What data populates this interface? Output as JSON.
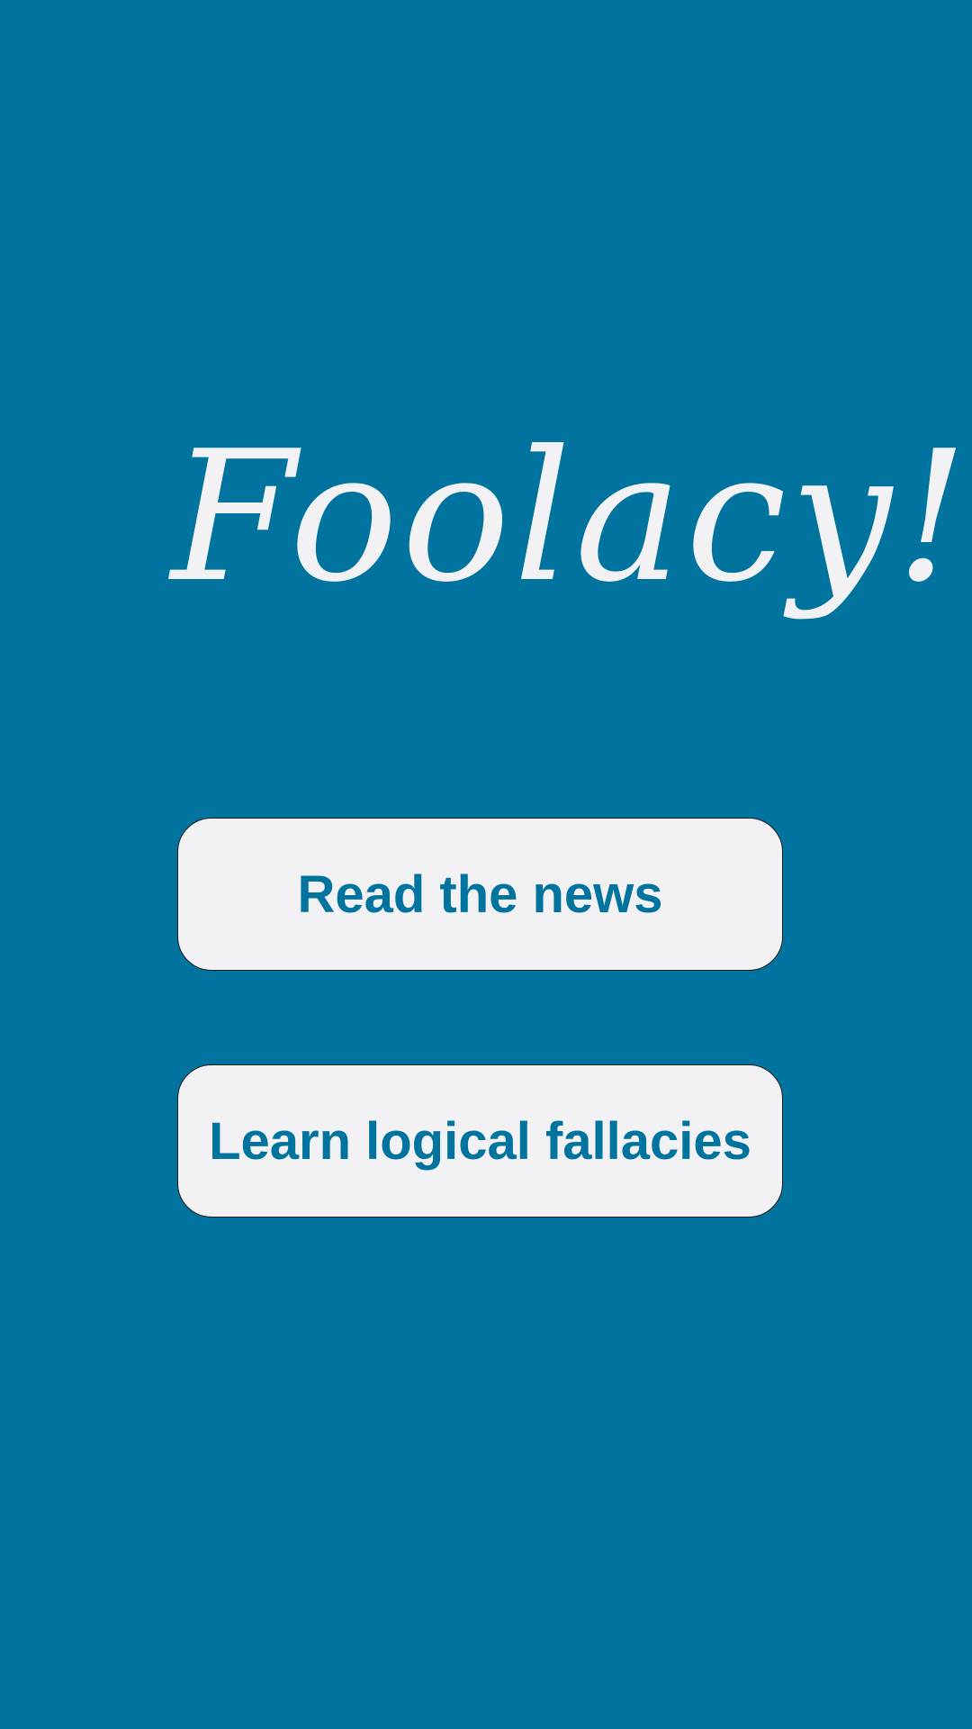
{
  "app": {
    "title": "Foolacy!"
  },
  "menu": {
    "read_news_label": "Read the news",
    "learn_fallacies_label": "Learn logical fallacies"
  },
  "colors": {
    "background": "#00739E",
    "button_background": "#F2F2F4",
    "button_text": "#00739E",
    "title_text": "#F2F2F4"
  }
}
